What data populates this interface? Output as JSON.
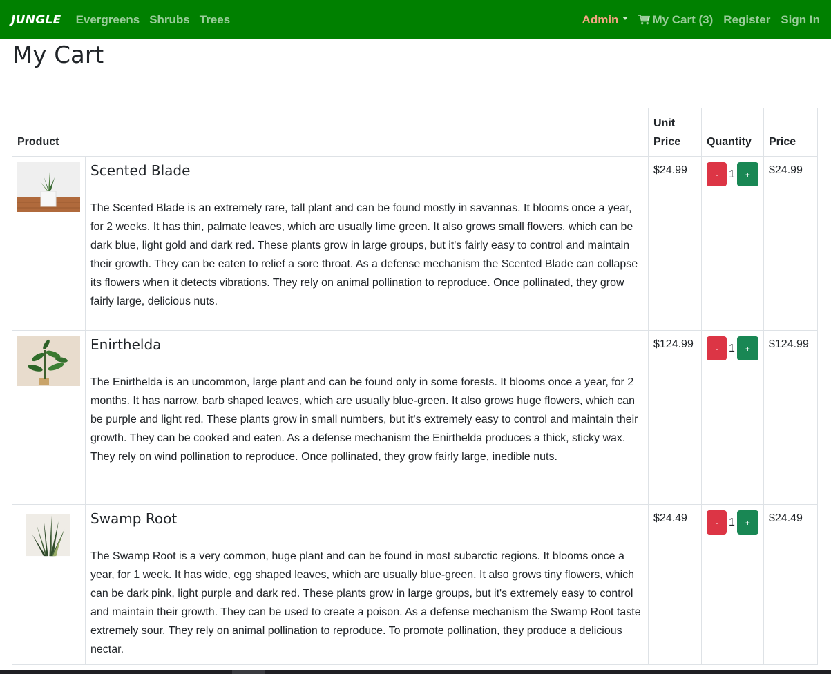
{
  "navbar": {
    "brand": "JUNGLE",
    "links": [
      "Evergreens",
      "Shrubs",
      "Trees"
    ],
    "admin_label": "Admin",
    "cart_label": "My Cart (3)",
    "register_label": "Register",
    "signin_label": "Sign In"
  },
  "page": {
    "title": "My Cart"
  },
  "table": {
    "headers": {
      "product": "Product",
      "unit_price": "Unit Price",
      "quantity": "Quantity",
      "price": "Price"
    },
    "rows": [
      {
        "name": "Scented Blade",
        "description": "The Scented Blade is an extremely rare, tall plant and can be found mostly in savannas. It blooms once a year, for 2 weeks. It has thin, palmate leaves, which are usually lime green. It also grows small flowers, which can be dark blue, light gold and dark red. These plants grow in large groups, but it's fairly easy to control and maintain their growth. They can be eaten to relief a sore throat. As a defense mechanism the Scented Blade can collapse its flowers when it detects vibrations. They rely on animal pollination to reproduce. Once pollinated, they grow fairly large, delicious nuts.",
        "unit_price": "$24.99",
        "minus": "-",
        "quantity": "1",
        "plus": "+",
        "price": "$24.99"
      },
      {
        "name": "Enirthelda",
        "description": "The Enirthelda is an uncommon, large plant and can be found only in some forests. It blooms once a year, for 2 months. It has narrow, barb shaped leaves, which are usually blue-green. It also grows huge flowers, which can be purple and light red. These plants grow in small numbers, but it's extremely easy to control and maintain their growth. They can be cooked and eaten. As a defense mechanism the Enirthelda produces a thick, sticky wax. They rely on wind pollination to reproduce. Once pollinated, they grow fairly large, inedible nuts.",
        "unit_price": "$124.99",
        "minus": "-",
        "quantity": "1",
        "plus": "+",
        "price": "$124.99"
      },
      {
        "name": "Swamp Root",
        "description": "The Swamp Root is a very common, huge plant and can be found in most subarctic regions. It blooms once a year, for 1 week. It has wide, egg shaped leaves, which are usually blue-green. It also grows tiny flowers, which can be dark pink, light purple and dark red. These plants grow in large groups, but it's extremely easy to control and maintain their growth. They can be used to create a poison. As a defense mechanism the Swamp Root taste extremely sour. They rely on animal pollination to reproduce. To promote pollination, they produce a delicious nectar.",
        "unit_price": "$24.49",
        "minus": "-",
        "quantity": "1",
        "plus": "+",
        "price": "$24.49"
      }
    ]
  },
  "colors": {
    "navbar_bg": "#008000",
    "admin": "#f4a582",
    "minus_button": "#dc3545",
    "plus_button": "#198754"
  },
  "icons": [
    "cart-icon",
    "caret-down-icon"
  ]
}
